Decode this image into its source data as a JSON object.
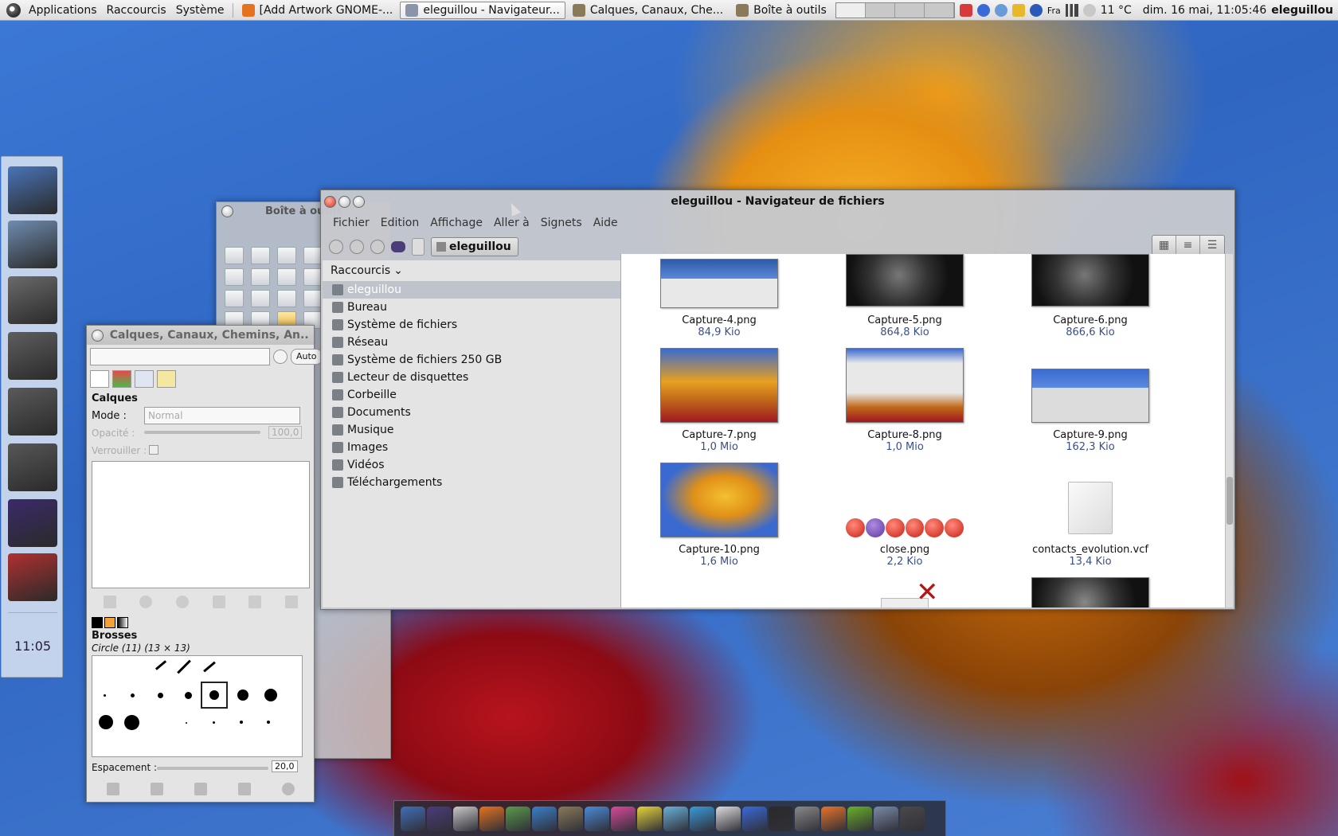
{
  "top_panel": {
    "menus": [
      "Applications",
      "Raccourcis",
      "Système"
    ],
    "tasks": [
      {
        "label": "[Add Artwork GNOME-...",
        "icon": "firefox-icon",
        "color": "#e4721f",
        "active": false
      },
      {
        "label": "eleguillou - Navigateur...",
        "icon": "folder-icon",
        "color": "#8a96a8",
        "active": true
      },
      {
        "label": "Calques, Canaux, Che...",
        "icon": "gimp-icon",
        "color": "#8a7a5a",
        "active": false
      },
      {
        "label": "Boîte à outils",
        "icon": "gimp-icon",
        "color": "#8a7a5a",
        "active": false
      }
    ],
    "keyboard_layout": "Fra",
    "weather": "11 °C",
    "clock": "dim. 16 mai, 11:05:46",
    "user": "eleguillou"
  },
  "left_dock": {
    "items": [
      {
        "name": "computer",
        "color": "#4a74b8"
      },
      {
        "name": "home",
        "color": "#6f8cb0"
      },
      {
        "name": "documents",
        "color": "#6a6a6a"
      },
      {
        "name": "music",
        "color": "#5e5e5e"
      },
      {
        "name": "pictures",
        "color": "#5a5a5a"
      },
      {
        "name": "videos",
        "color": "#575757"
      },
      {
        "name": "search",
        "color": "#3b2a6a"
      },
      {
        "name": "settings",
        "color": "#b03030"
      }
    ],
    "clock": "11:05"
  },
  "toolbox": {
    "title": "Boîte à outils"
  },
  "layers": {
    "title": "Calques, Canaux, Chemins, An...",
    "auto_button": "Auto",
    "section_title": "Calques",
    "mode_label": "Mode :",
    "mode_value": "Normal",
    "opacity_label": "Opacité :",
    "opacity_value": "100,0",
    "lock_label": "Verrouiller :",
    "brushes_title": "Brosses",
    "brush_name": "Circle (11) (13 × 13)",
    "spacing_label": "Espacement :",
    "spacing_value": "20,0"
  },
  "file_manager": {
    "title": "eleguillou - Navigateur de fichiers",
    "menu": [
      "Fichier",
      "Edition",
      "Affichage",
      "Aller à",
      "Signets",
      "Aide"
    ],
    "path_button": "eleguillou",
    "sidebar_header": "Raccourcis",
    "places": [
      {
        "label": "eleguillou",
        "selected": true
      },
      {
        "label": "Bureau",
        "selected": false
      },
      {
        "label": "Système de fichiers",
        "selected": false
      },
      {
        "label": "Réseau",
        "selected": false
      },
      {
        "label": "Système de fichiers 250 GB",
        "selected": false
      },
      {
        "label": "Lecteur de disquettes",
        "selected": false
      },
      {
        "label": "Corbeille",
        "selected": false
      },
      {
        "label": "Documents",
        "selected": false
      },
      {
        "label": "Musique",
        "selected": false
      },
      {
        "label": "Images",
        "selected": false
      },
      {
        "label": "Vidéos",
        "selected": false
      },
      {
        "label": "Téléchargements",
        "selected": false
      }
    ],
    "files": [
      {
        "name": "Capture-4.png",
        "size": "84,9 Kio"
      },
      {
        "name": "Capture-5.png",
        "size": "864,8 Kio"
      },
      {
        "name": "Capture-6.png",
        "size": "866,6 Kio"
      },
      {
        "name": "Capture-7.png",
        "size": "1,0 Mio"
      },
      {
        "name": "Capture-8.png",
        "size": "1,0 Mio"
      },
      {
        "name": "Capture-9.png",
        "size": "162,3 Kio"
      },
      {
        "name": "Capture-10.png",
        "size": "1,6 Mio"
      },
      {
        "name": "close.png",
        "size": "2,2 Kio"
      },
      {
        "name": "contacts_evolution.vcf",
        "size": "13,4 Kio"
      }
    ]
  },
  "bottom_dock": {
    "items": [
      {
        "name": "anchor",
        "color": "#3f6fb8"
      },
      {
        "name": "binoculars",
        "color": "#4b3c7a"
      },
      {
        "name": "mail",
        "color": "#c9c9c9"
      },
      {
        "name": "firefox",
        "color": "#e4721f"
      },
      {
        "name": "contacts",
        "color": "#5a9a4a"
      },
      {
        "name": "globe",
        "color": "#3a7fc8"
      },
      {
        "name": "gimp",
        "color": "#8a7a5a"
      },
      {
        "name": "blender",
        "color": "#4a8ad8"
      },
      {
        "name": "picasa",
        "color": "#d84a9a"
      },
      {
        "name": "notes",
        "color": "#e6d23a"
      },
      {
        "name": "files",
        "color": "#6ab0d8"
      },
      {
        "name": "bird",
        "color": "#3a9ad8"
      },
      {
        "name": "keyboard",
        "color": "#dcdcdc"
      },
      {
        "name": "pointer",
        "color": "#3a6ad8"
      },
      {
        "name": "terminal",
        "color": "#2a2a2a"
      },
      {
        "name": "archive",
        "color": "#8a8a8a"
      },
      {
        "name": "update",
        "color": "#e8722a"
      },
      {
        "name": "nvidia",
        "color": "#6ab02a"
      },
      {
        "name": "drive",
        "color": "#7a8aa8"
      },
      {
        "name": "trash",
        "color": "#4a4a4a"
      }
    ]
  }
}
